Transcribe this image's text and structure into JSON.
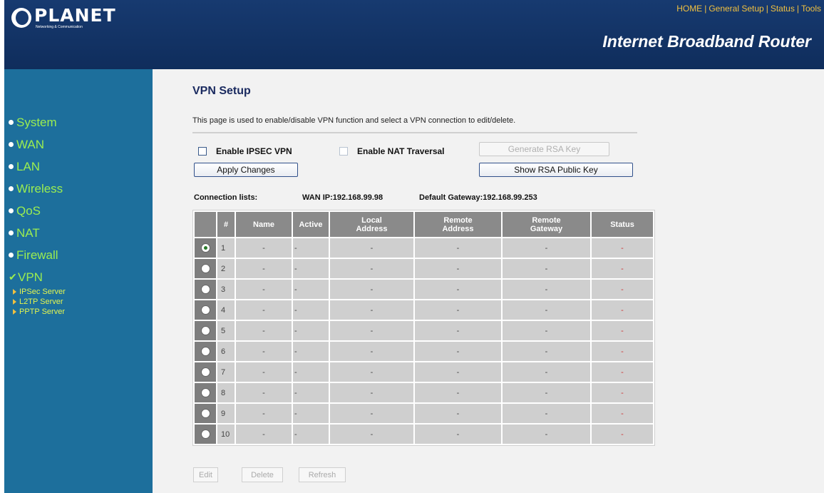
{
  "header": {
    "logo_name": "PLANET",
    "logo_tagline": "Networking & Communication",
    "product_title": "Internet Broadband Router",
    "top_nav": [
      "HOME",
      "General Setup",
      "Status",
      "Tools"
    ],
    "top_nav_separator": "|"
  },
  "sidebar": {
    "items": [
      {
        "label": "System"
      },
      {
        "label": "WAN"
      },
      {
        "label": "LAN"
      },
      {
        "label": "Wireless"
      },
      {
        "label": "QoS"
      },
      {
        "label": "NAT"
      },
      {
        "label": "Firewall"
      },
      {
        "label": "VPN",
        "selected": true
      }
    ],
    "sub_items": [
      {
        "label": "IPSec Server"
      },
      {
        "label": "L2TP Server"
      },
      {
        "label": "PPTP Server"
      }
    ]
  },
  "main": {
    "title": "VPN Setup",
    "description": "This page is used to enable/disable VPN function and select a VPN connection to edit/delete.",
    "enable_ipsec_label": "Enable IPSEC VPN",
    "enable_ipsec_checked": false,
    "enable_nat_label": "Enable NAT Traversal",
    "enable_nat_checked": false,
    "generate_rsa_label": "Generate RSA Key",
    "apply_label": "Apply Changes",
    "show_rsa_label": "Show RSA Public Key",
    "connection_lists_label": "Connection lists:",
    "wan_ip_text": "WAN IP:192.168.99.98",
    "gateway_text": "Default Gateway:192.168.99.253",
    "table": {
      "headers": [
        "",
        "#",
        "Name",
        "Active",
        "Local\nAddress",
        "Remote\nAddress",
        "Remote\nGateway",
        "Status"
      ],
      "rows": [
        {
          "num": "1",
          "name": "-",
          "active": "-",
          "local": "-",
          "remote": "-",
          "gateway": "-",
          "status": "-",
          "selected": true
        },
        {
          "num": "2",
          "name": "-",
          "active": "-",
          "local": "-",
          "remote": "-",
          "gateway": "-",
          "status": "-",
          "selected": false
        },
        {
          "num": "3",
          "name": "-",
          "active": "-",
          "local": "-",
          "remote": "-",
          "gateway": "-",
          "status": "-",
          "selected": false
        },
        {
          "num": "4",
          "name": "-",
          "active": "-",
          "local": "-",
          "remote": "-",
          "gateway": "-",
          "status": "-",
          "selected": false
        },
        {
          "num": "5",
          "name": "-",
          "active": "-",
          "local": "-",
          "remote": "-",
          "gateway": "-",
          "status": "-",
          "selected": false
        },
        {
          "num": "6",
          "name": "-",
          "active": "-",
          "local": "-",
          "remote": "-",
          "gateway": "-",
          "status": "-",
          "selected": false
        },
        {
          "num": "7",
          "name": "-",
          "active": "-",
          "local": "-",
          "remote": "-",
          "gateway": "-",
          "status": "-",
          "selected": false
        },
        {
          "num": "8",
          "name": "-",
          "active": "-",
          "local": "-",
          "remote": "-",
          "gateway": "-",
          "status": "-",
          "selected": false
        },
        {
          "num": "9",
          "name": "-",
          "active": "-",
          "local": "-",
          "remote": "-",
          "gateway": "-",
          "status": "-",
          "selected": false
        },
        {
          "num": "10",
          "name": "-",
          "active": "-",
          "local": "-",
          "remote": "-",
          "gateway": "-",
          "status": "-",
          "selected": false
        }
      ]
    },
    "edit_label": "Edit",
    "delete_label": "Delete",
    "refresh_label": "Refresh"
  },
  "colors": {
    "header_bg": "#173a70",
    "sidebar_bg": "#1d6f9c",
    "menu_text": "#9cee50",
    "nav_text": "#f0c040",
    "table_header": "#8a8a8a",
    "table_cell": "#cfcfcf",
    "status_red": "#cc3333"
  }
}
